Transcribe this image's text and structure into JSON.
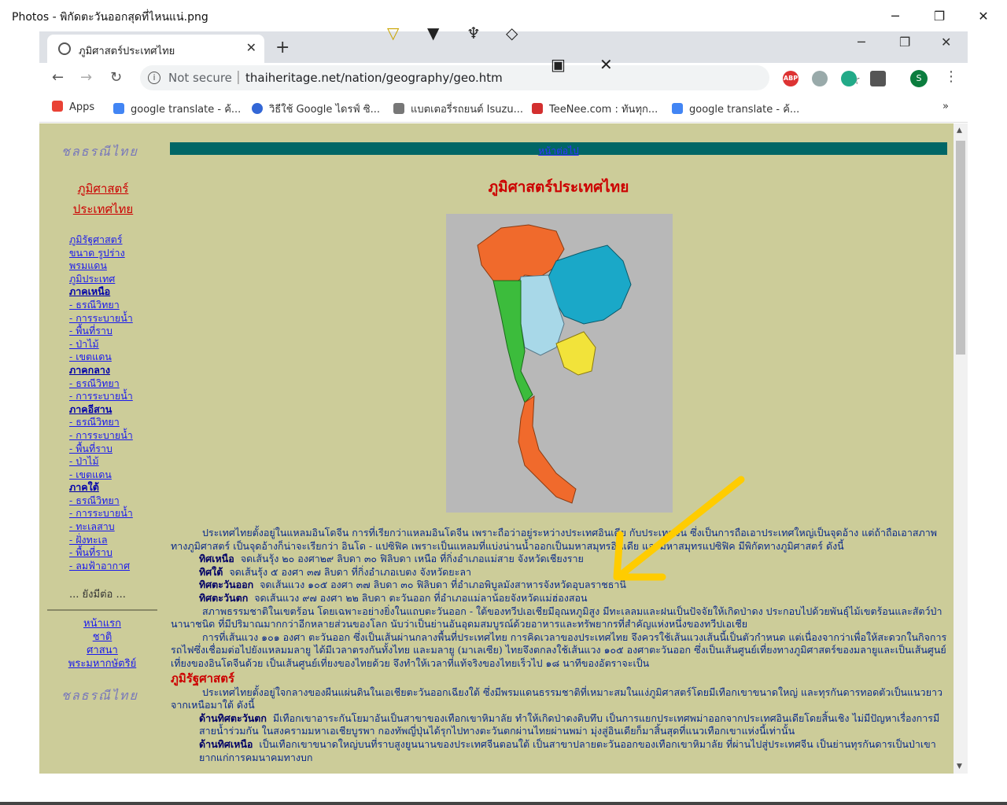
{
  "photos": {
    "title": "Photos - พิกัดตะวันออกสุดที่ไหนแน่.png",
    "minimize": "─",
    "restore": "❐",
    "close": "✕"
  },
  "chrome": {
    "tab_title": "ภูมิศาสตร์ประเทศไทย",
    "tab_close": "✕",
    "new_tab": "+",
    "minimize": "─",
    "restore": "❐",
    "close": "✕",
    "not_secure": "Not secure",
    "url": "thaiheritage.net/nation/geography/geo.htm",
    "profile_initial": "S",
    "ext_abp": "ABP"
  },
  "markup": {
    "pen1": "▽",
    "pen2": "▼",
    "pen3": "♆",
    "eraser": "◇",
    "save": "▣",
    "close": "✕"
  },
  "bookmarks": [
    {
      "label": "Apps",
      "color": "#e94235"
    },
    {
      "label": "google translate - ค้...",
      "color": "#4285f4"
    },
    {
      "label": "วิธีใช้ Google ไดรฟ์ ซิ...",
      "color": "#3367d6"
    },
    {
      "label": "แบตเตอรี่รถยนต์ Isuzu...",
      "color": "#777777"
    },
    {
      "label": "TeeNee.com : ทันทุก...",
      "color": "#d32f2f"
    },
    {
      "label": "google translate - ค้...",
      "color": "#4285f4"
    }
  ],
  "bookmarks_more": "»",
  "sidebar": {
    "logo": "ชลธรณีไทย",
    "title_line1": "ภูมิศาสตร์",
    "title_line2": "ประเทศไทย",
    "links": [
      {
        "label": "ภูมิรัฐศาสตร์",
        "bold": false
      },
      {
        "label": "ขนาด รูปร่าง",
        "bold": false
      },
      {
        "label": "พรมแดน",
        "bold": false
      },
      {
        "label": "ภูมิประเทศ",
        "bold": false
      },
      {
        "label": "ภาคเหนือ",
        "bold": true
      },
      {
        "label": "- ธรณีวิทยา",
        "bold": false
      },
      {
        "label": "- การระบายน้ำ",
        "bold": false
      },
      {
        "label": "- พื้นที่ราบ",
        "bold": false
      },
      {
        "label": "- ป่าไม้",
        "bold": false
      },
      {
        "label": "- เขตแดน",
        "bold": false
      },
      {
        "label": "ภาคกลาง",
        "bold": true
      },
      {
        "label": "- ธรณีวิทยา",
        "bold": false
      },
      {
        "label": "- การระบายน้ำ",
        "bold": false
      },
      {
        "label": "ภาคอีสาน",
        "bold": true
      },
      {
        "label": "- ธรณีวิทยา",
        "bold": false
      },
      {
        "label": "- การระบายน้ำ",
        "bold": false
      },
      {
        "label": "- พื้นที่ราบ",
        "bold": false
      },
      {
        "label": "- ป่าไม้",
        "bold": false
      },
      {
        "label": "- เขตแดน",
        "bold": false
      },
      {
        "label": "ภาคใต้",
        "bold": true
      },
      {
        "label": "- ธรณีวิทยา",
        "bold": false
      },
      {
        "label": "- การระบายน้ำ",
        "bold": false
      },
      {
        "label": "- ทะเลสาบ",
        "bold": false
      },
      {
        "label": "- ฝั่งทะเล",
        "bold": false
      },
      {
        "label": "- พื้นที่ราบ",
        "bold": false
      },
      {
        "label": "- ลมฟ้าอากาศ",
        "bold": false
      }
    ],
    "more": "... ยังมีต่อ ...",
    "links2": [
      "หน้าแรก",
      "ชาติ",
      "ศาสนา",
      "พระมหากษัตริย์"
    ]
  },
  "main": {
    "next_page": "หน้าต่อไป",
    "title": "ภูมิศาสตร์ประเทศไทย",
    "intro": "ประเทศไทยตั้งอยู่ในแหลมอินโดจีน  การที่เรียกว่าแหลมอินโดจีน เพราะถือว่าอยู่ระหว่างประเทศอินเดีย กับประเทศจีน ซึ่งเป็นการถือเอาประเทศใหญ่เป็นจุดอ้าง แต่ถ้าถือเอาสภาพทางภูมิศาสตร์ เป็นจุดอ้างก็น่าจะเรียกว่า อินโด - แปซิฟิค เพราะเป็นแหลมที่แบ่งน่านน้ำออกเป็นมหาสมุทรอินเดีย และมหาสมุทรแปซิฟิค มีพิกัดทางภูมิศาสตร์ ดังนี้",
    "points": [
      {
        "key": "ทิศเหนือ",
        "text": "จดเส้นรุ้ง ๒๐ องศา๒๙ ลิบดา ๓๐ ฟิลิบดา เหนือ ที่กิ่งอำเภอแม่สาย จังหวัดเชียงราย"
      },
      {
        "key": "ทิศใต้",
        "text": "จดเส้นรุ้ง ๕ องศา ๓๗ ลิบดา ที่กิ่งอำเภอเบตง จังหวัดยะลา"
      },
      {
        "key": "ทิศตะวันออก",
        "text": "จดเส้นแวง ๑๐๕ องศา ๓๗ ลิบดา ๓๐ ฟิลิบดา ที่อำเภอพิบูลมังสาหารจังหวัดอุบลราชธานี"
      },
      {
        "key": "ทิศตะวันตก",
        "text": "จดเส้นแวง ๙๗ องศา ๒๒ ลิบดา ตะวันออก ที่อำเภอแม่ลาน้อยจังหวัดแม่ฮ่องสอน"
      }
    ],
    "para2": "สภาพธรรมชาติในเขตร้อน โดยเฉพาะอย่างยิ่งในแถบตะวันออก - ใต้ของทวีปเอเชียมีอุณหภูมิสูง มีทะเลลมและฝนเป็นปัจจัยให้เกิดป่าดง ประกอบไปด้วยพันธุ์ไม้เขตร้อนและสัตว์ป่านานาชนิด ที่มีปริมาณมากกว่าอีกหลายส่วนของโลก นับว่าเป็นย่านอันอุดมสมบูรณ์ด้วยอาหารและทรัพยากรที่สำคัญแห่งหนึ่งของทวีปเอเชีย",
    "para3": "การที่เส้นแวง ๑๐๑ องศา ตะวันออก ซึ่งเป็นเส้นผ่านกลางพื้นที่ประเทศไทย การคิดเวลาของประเทศไทย จึงควรใช้เส้นแวงเส้นนี้เป็นตัวกำหนด  แต่เนื่องจากว่าเพื่อให้สะดวกในกิจการรถไฟซึ่งเชื่อมต่อไปยังแหลมมลายู ได้มีเวลาตรงกันทั้งไทย และมลายู (มาเลเซีย) ไทยจึงตกลงใช้เส้นแวง ๑๐๕ องศาตะวันออก ซึ่งเป็นเส้นศูนย์เที่ยงทางภูมิศาสตร์ของมลายูและเป็นเส้นศูนย์เที่ยงของอินโดจีนด้วย เป็นเส้นศูนย์เที่ยงของไทยด้วย จึงทำให้เวลาที่แท้จริงของไทยเร็วไป ๑๘ นาทีของอัตราจะเป็น",
    "section": "ภูมิรัฐศาสตร์",
    "para4": "ประเทศไทยตั้งอยู่ใจกลางของผืนแผ่นดินในเอเชียตะวันออกเฉียงใต้  ซึ่งมีพรมแดนธรรมชาติที่เหมาะสมในแง่ภูมิศาสตร์โดยมีเทือกเขาขนาดใหญ่ และทุรกันดารทอดตัวเป็นแนวยาวจากเหนือมาใต้ ดังนี้",
    "geo_points": [
      {
        "key": "ด้านทิศตะวันตก",
        "text": "มีเทือกเขาอาระกันโยมาอันเป็นสาขาของเทือกเขาหิมาลัย ทำให้เกิดป่าดงดิบทึบ เป็นการแยกประเทศพม่าออกจากประเทศอินเดียโดยสิ้นเชิง ไม่มีปัญหาเรื่องการมีสายน้ำร่วมกัน  ในสงครามมหาเอเชียบูรพา  กองทัพญี่ปุ่นได้รุกไปทางตะวันตกผ่านไทยผ่านพม่า มุ่งสู่อินเดียก็มาสิ้นสุดที่แนวเทือกเขาแห่งนี้เท่านั้น"
      },
      {
        "key": "ด้านทิศเหนือ",
        "text": "เป็นเทือกเขาขนาดใหญ่บนที่ราบสูงยูนนานของประเทศจีนตอนใต้ เป็นสาขาปลายตะวันออกของเทือกเขาหิมาลัย ที่ผ่านไปสู่ประเทศจีน เป็นย่านทุรกันดารเป็นป่าเขายากแก่การคมนาคมทางบก"
      }
    ]
  },
  "colors": {
    "page_bg": "#cccc99",
    "accent_red": "#cc0000",
    "topbar": "#006666",
    "arrow": "#ffcc00"
  }
}
